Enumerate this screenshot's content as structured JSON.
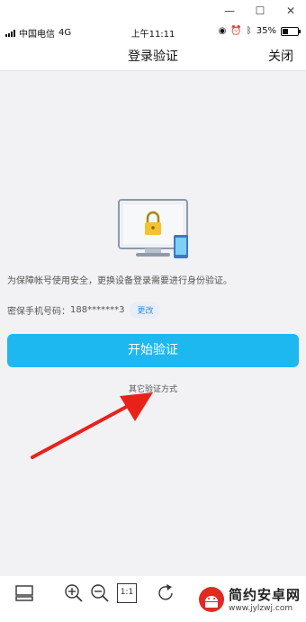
{
  "window": {
    "minimize_label": "—",
    "maximize_label": "☐",
    "close_label": "✕"
  },
  "status_bar": {
    "carrier": "中国电信",
    "network": "4G",
    "time": "上午11:11",
    "battery": "35%",
    "battery_level": 0.35
  },
  "nav": {
    "title": "登录验证",
    "close_label": "关闭"
  },
  "notice": "为保障帐号使用安全，更换设备登录需要进行身份验证。",
  "phone": {
    "label": "密保手机号码：",
    "value": "188*******3",
    "change_label": "更改"
  },
  "start_button": "开始验证",
  "other_methods": "其它验证方式",
  "toolbar": {
    "actual_size_label": "1:1"
  },
  "watermark": {
    "brand": "简约安卓网",
    "url": "www.jylzwj.com"
  },
  "colors": {
    "accent": "#1eb8f0",
    "arrow": "#e8221b",
    "link": "#3d8bd1"
  }
}
